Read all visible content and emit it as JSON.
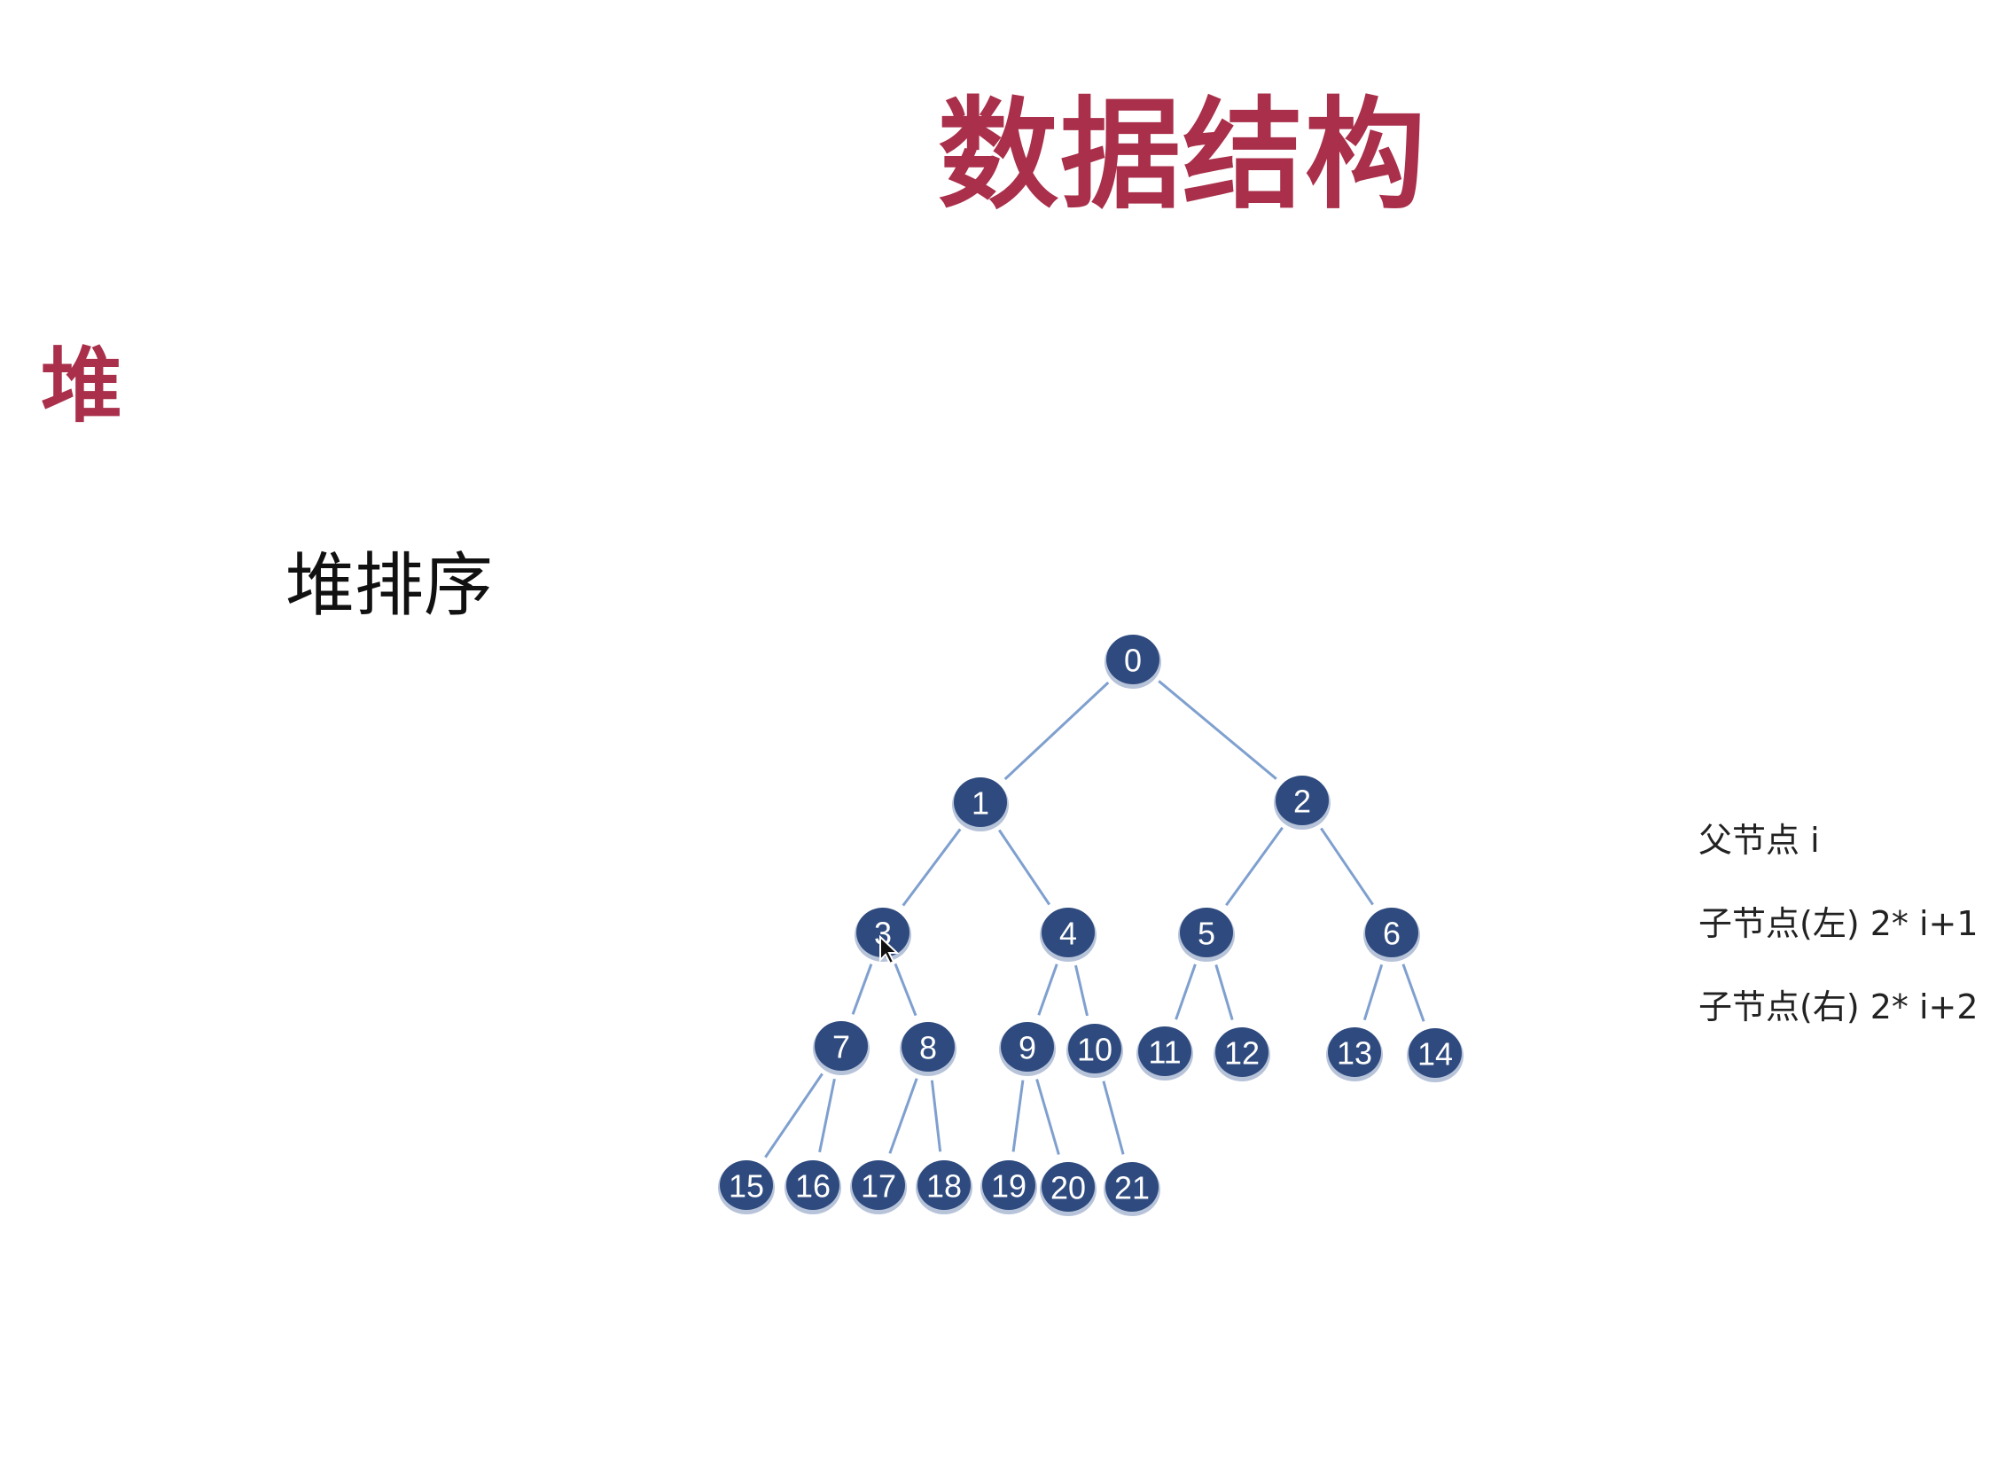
{
  "slide": {
    "title": "数据结构",
    "section": "堆",
    "subtitle": "堆排序"
  },
  "tree": {
    "nodes": [
      "0",
      "1",
      "2",
      "3",
      "4",
      "5",
      "6",
      "7",
      "8",
      "9",
      "10",
      "11",
      "12",
      "13",
      "14",
      "15",
      "16",
      "17",
      "18",
      "19",
      "20",
      "21"
    ],
    "edges": [
      [
        "0",
        "1"
      ],
      [
        "0",
        "2"
      ],
      [
        "1",
        "3"
      ],
      [
        "1",
        "4"
      ],
      [
        "2",
        "5"
      ],
      [
        "2",
        "6"
      ],
      [
        "3",
        "7"
      ],
      [
        "3",
        "8"
      ],
      [
        "4",
        "9"
      ],
      [
        "4",
        "10"
      ],
      [
        "5",
        "11"
      ],
      [
        "5",
        "12"
      ],
      [
        "6",
        "13"
      ],
      [
        "6",
        "14"
      ],
      [
        "7",
        "15"
      ],
      [
        "7",
        "16"
      ],
      [
        "8",
        "17"
      ],
      [
        "8",
        "18"
      ],
      [
        "9",
        "19"
      ],
      [
        "9",
        "20"
      ],
      [
        "10",
        "21"
      ]
    ],
    "node_color": "#2e4a7e",
    "edge_color": "#7fa0cf"
  },
  "notes": {
    "parent": "父节点  i",
    "left_child": "子节点(左) 2* i+1",
    "right_child": "子节点(右) 2* i+2"
  },
  "colors": {
    "heading": "#a92f4a"
  }
}
